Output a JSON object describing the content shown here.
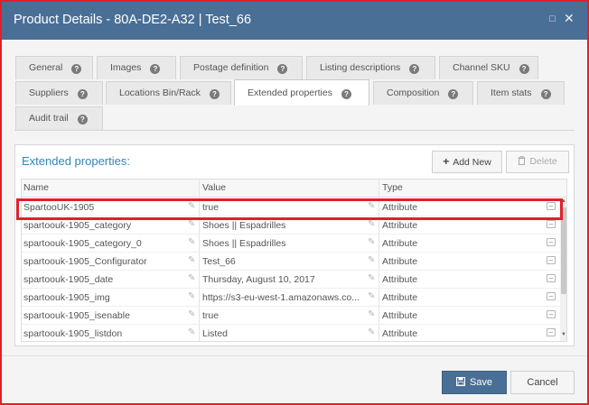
{
  "window": {
    "title": "Product Details - 80A-DE2-A32 | Test_66",
    "restore_icon": "□",
    "close_icon": "✕"
  },
  "tabs": [
    {
      "label": "General"
    },
    {
      "label": "Images"
    },
    {
      "label": "Postage definition"
    },
    {
      "label": "Listing descriptions"
    },
    {
      "label": "Channel SKU"
    },
    {
      "label": "Suppliers"
    },
    {
      "label": "Locations Bin/Rack"
    },
    {
      "label": "Extended properties",
      "active": true
    },
    {
      "label": "Composition"
    },
    {
      "label": "Item stats"
    },
    {
      "label": "Audit trail"
    }
  ],
  "panel": {
    "title": "Extended properties:",
    "add_new_label": "Add New",
    "delete_label": "Delete"
  },
  "grid": {
    "columns": [
      "Name",
      "Value",
      "Type"
    ],
    "rows": [
      {
        "name": "SpartooUK-1905",
        "value": "true",
        "type": "Attribute"
      },
      {
        "name": "spartoouk-1905_category",
        "value": "Shoes || Espadrilles",
        "type": "Attribute"
      },
      {
        "name": "spartoouk-1905_category_0",
        "value": "Shoes || Espadrilles",
        "type": "Attribute"
      },
      {
        "name": "spartoouk-1905_Configurator",
        "value": "Test_66",
        "type": "Attribute"
      },
      {
        "name": "spartoouk-1905_date",
        "value": "Thursday, August 10, 2017",
        "type": "Attribute"
      },
      {
        "name": "spartoouk-1905_img",
        "value": "https://s3-eu-west-1.amazonaws.co...",
        "type": "Attribute"
      },
      {
        "name": "spartoouk-1905_isenable",
        "value": "true",
        "type": "Attribute"
      },
      {
        "name": "spartoouk-1905_listdon",
        "value": "Listed",
        "type": "Attribute"
      }
    ]
  },
  "footer": {
    "save_label": "Save",
    "cancel_label": "Cancel"
  },
  "colors": {
    "titlebar": "#4a6f96",
    "highlight": "#e0202a",
    "panel_title": "#2e86b8"
  }
}
